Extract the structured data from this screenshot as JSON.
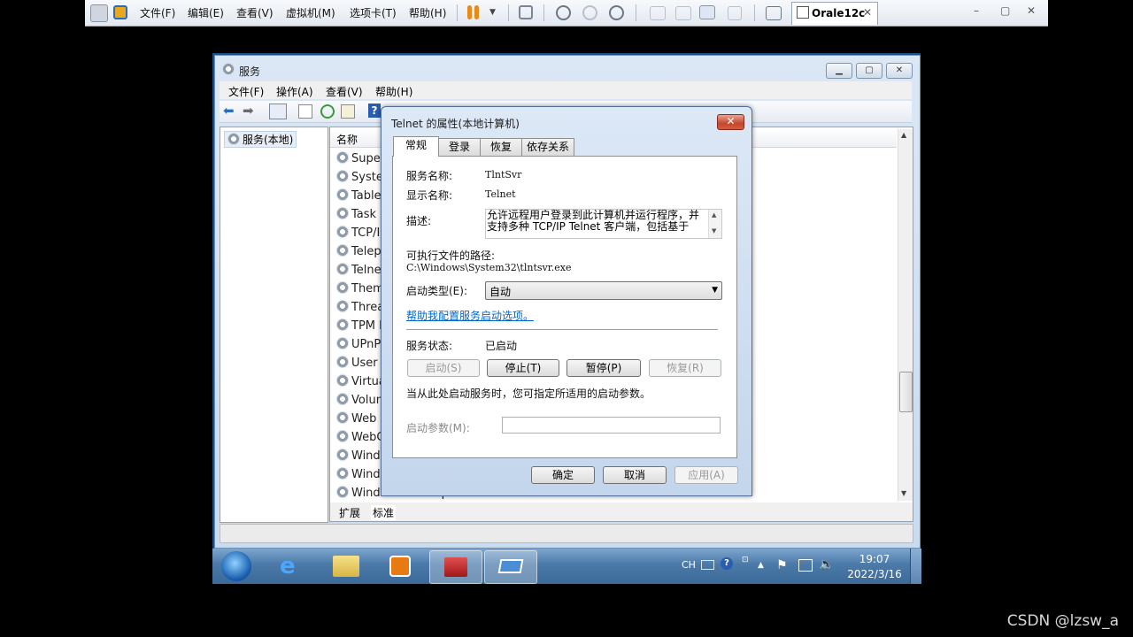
{
  "vmware": {
    "menu": [
      "文件(F)",
      "编辑(E)",
      "查看(V)",
      "虚拟机(M)",
      "选项卡(T)",
      "帮助(H)"
    ],
    "tab_title": "Orale12c",
    "tab_close": "✕",
    "window_controls": [
      "–",
      "▢",
      "✕"
    ]
  },
  "services_window": {
    "title": "服务",
    "menu": [
      "文件(F)",
      "操作(A)",
      "查看(V)",
      "帮助(H)"
    ],
    "tree_root": "服务(本地)",
    "column_name": "名称",
    "rows": [
      "Super",
      "Syster",
      "Table",
      "Task S",
      "TCP/II",
      "Telep",
      "Telnet",
      "Them",
      "Threa",
      "TPM E",
      "UPnP",
      "User P",
      "Virtua",
      "Volum",
      "Web D",
      "WebC",
      "Windo",
      "Windo",
      "Windows Backup"
    ],
    "bottom_tabs": [
      "扩展",
      "标准"
    ]
  },
  "dialog": {
    "title": "Telnet 的属性(本地计算机)",
    "close": "✕",
    "tabs": [
      "常规",
      "登录",
      "恢复",
      "依存关系"
    ],
    "service_name_label": "服务名称:",
    "service_name": "TlntSvr",
    "display_name_label": "显示名称:",
    "display_name": "Telnet",
    "description_label": "描述:",
    "description": "允许远程用户登录到此计算机并运行程序，并支持多种 TCP/IP Telnet 客户端，包括基于",
    "exe_path_label": "可执行文件的路径:",
    "exe_path": "C:\\Windows\\System32\\tlntsvr.exe",
    "startup_type_label": "启动类型(E):",
    "startup_type": "自动",
    "help_link": "帮助我配置服务启动选项。",
    "status_label": "服务状态:",
    "status": "已启动",
    "buttons": {
      "start": "启动(S)",
      "stop": "停止(T)",
      "pause": "暂停(P)",
      "resume": "恢复(R)"
    },
    "params_hint": "当从此处启动服务时，您可指定所适用的启动参数。",
    "params_label": "启动参数(M):",
    "params_value": "",
    "ok": "确定",
    "cancel": "取消",
    "apply": "应用(A)"
  },
  "taskbar": {
    "lang": "CH",
    "time": "19:07",
    "date": "2022/3/16"
  },
  "watermark": "CSDN @lzsw_a"
}
